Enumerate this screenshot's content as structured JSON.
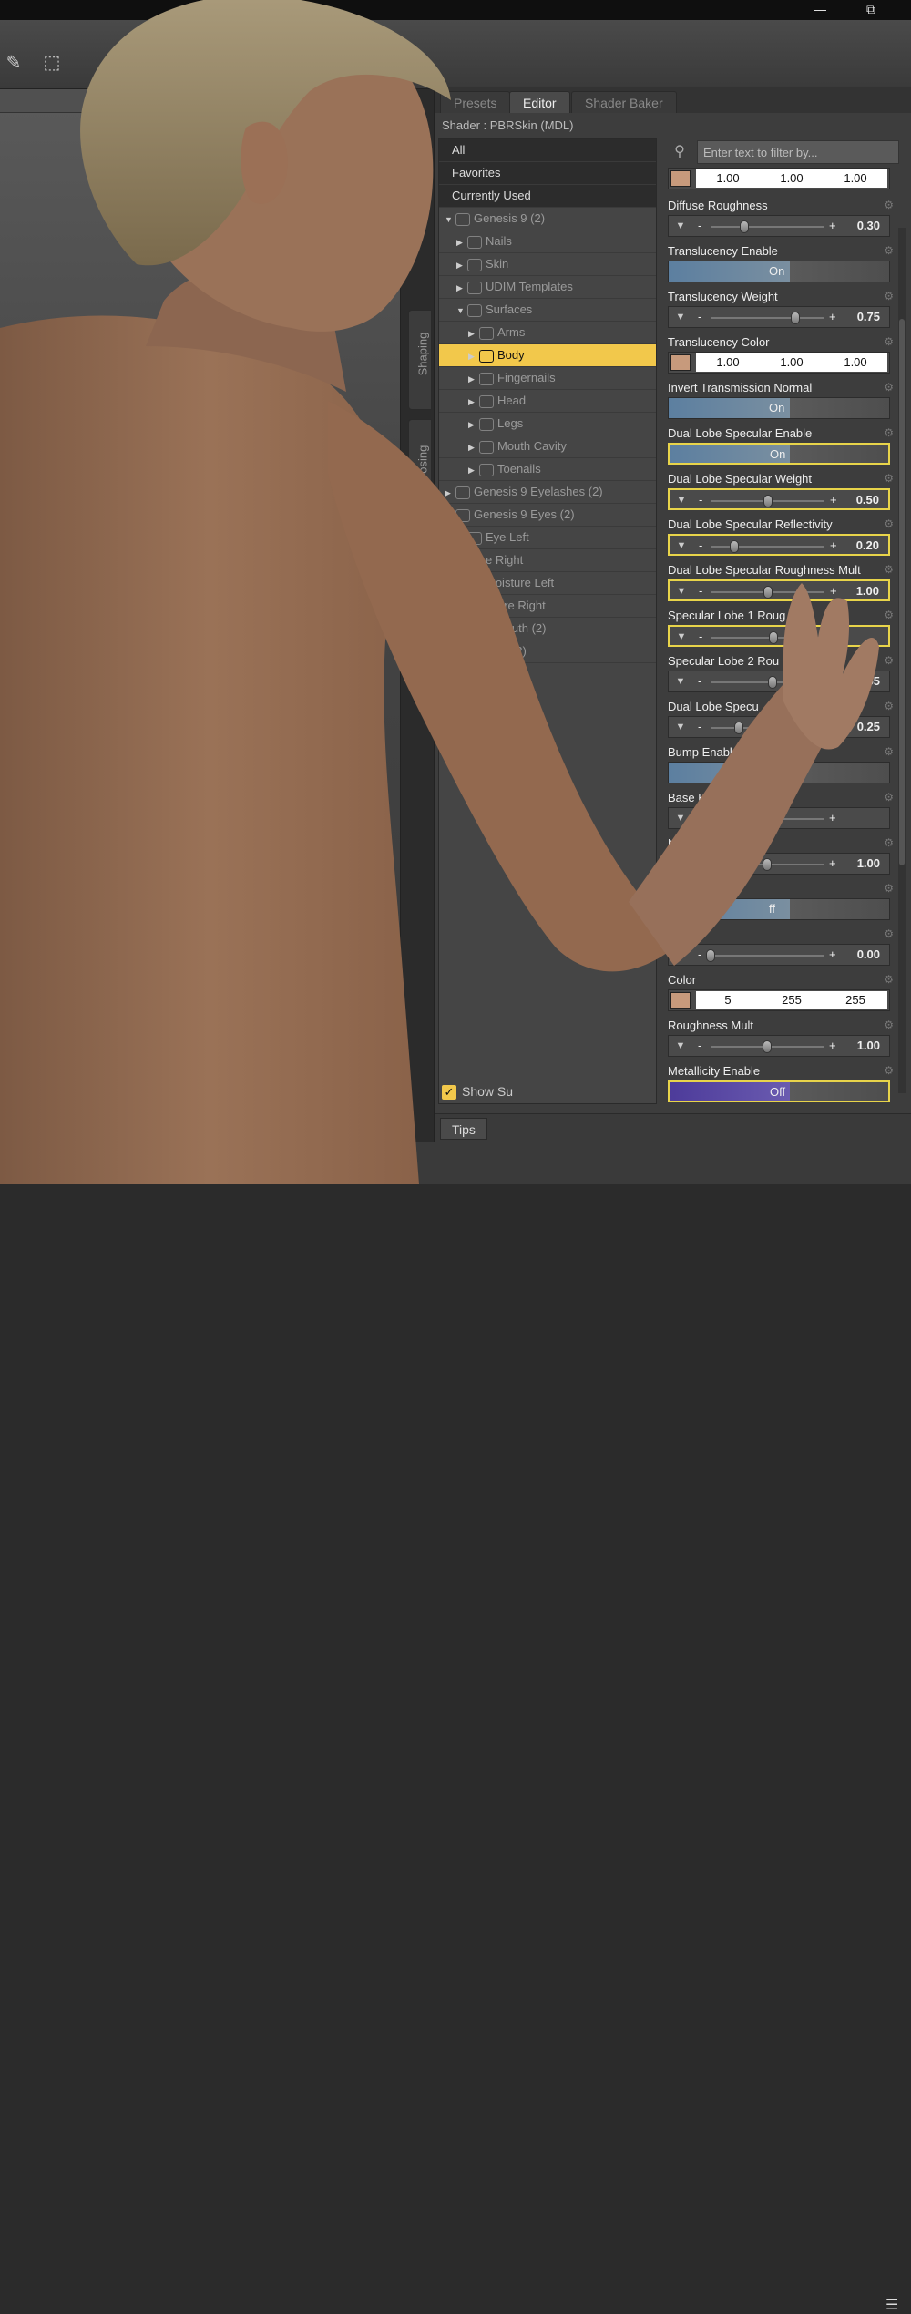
{
  "window": {
    "minimize": "—",
    "restore": "⧉"
  },
  "panel": {
    "tabs": [
      "Presets",
      "Editor",
      "Shader Baker"
    ],
    "shader_label": "Shader : PBRSkin (MDL)",
    "filter_placeholder": "Enter text to filter by...",
    "show_sub": "Show Su",
    "tips": "Tips"
  },
  "side_tabs": {
    "shaping": "Shaping",
    "posing": "Posing"
  },
  "tree": [
    {
      "label": "All",
      "type": "top"
    },
    {
      "label": "Favorites",
      "type": "top"
    },
    {
      "label": "Currently Used",
      "type": "top"
    },
    {
      "label": "Genesis 9 (2)",
      "indent": 0,
      "arrow": "▼"
    },
    {
      "label": "Nails",
      "indent": 1,
      "arrow": "▶"
    },
    {
      "label": "Skin",
      "indent": 1,
      "arrow": "▶"
    },
    {
      "label": "UDIM Templates",
      "indent": 1,
      "arrow": "▶"
    },
    {
      "label": "Surfaces",
      "indent": 1,
      "arrow": "▼"
    },
    {
      "label": "Arms",
      "indent": 2,
      "arrow": "▶"
    },
    {
      "label": "Body",
      "indent": 2,
      "arrow": "▶",
      "selected": true
    },
    {
      "label": "Fingernails",
      "indent": 2,
      "arrow": "▶"
    },
    {
      "label": "Head",
      "indent": 2,
      "arrow": "▶"
    },
    {
      "label": "Legs",
      "indent": 2,
      "arrow": "▶"
    },
    {
      "label": "Mouth Cavity",
      "indent": 2,
      "arrow": "▶"
    },
    {
      "label": "Toenails",
      "indent": 2,
      "arrow": "▶"
    },
    {
      "label": "Genesis 9 Eyelashes (2)",
      "indent": 0,
      "arrow": "▶"
    },
    {
      "label": "Genesis 9 Eyes (2)",
      "indent": 0,
      "arrow": "▶"
    },
    {
      "label": "Eye Left",
      "indent": 1,
      "arrow": ""
    },
    {
      "label": "e Right",
      "indent": 1,
      "arrow": ""
    },
    {
      "label": "Moisture Left",
      "indent": 1,
      "arrow": ""
    },
    {
      "label": "isture Right",
      "indent": 1,
      "arrow": ""
    },
    {
      "label": "9 Mouth (2)",
      "indent": 1,
      "arrow": ""
    },
    {
      "label": "Tear (2)",
      "indent": 1,
      "arrow": ""
    }
  ],
  "properties": [
    {
      "label": "",
      "type": "color",
      "values": [
        "1.00",
        "1.00",
        "1.00"
      ]
    },
    {
      "label": "Diffuse Roughness",
      "type": "slider",
      "value": "0.30",
      "pos": 0.3
    },
    {
      "label": "Translucency Enable",
      "type": "toggle",
      "value": "On"
    },
    {
      "label": "Translucency Weight",
      "type": "slider",
      "value": "0.75",
      "pos": 0.75
    },
    {
      "label": "Translucency Color",
      "type": "color",
      "values": [
        "1.00",
        "1.00",
        "1.00"
      ]
    },
    {
      "label": "Invert Transmission Normal",
      "type": "toggle",
      "value": "On"
    },
    {
      "label": "Dual Lobe Specular Enable",
      "type": "toggle",
      "value": "On",
      "hl": true
    },
    {
      "label": "Dual Lobe Specular Weight",
      "type": "slider",
      "value": "0.50",
      "pos": 0.5,
      "hl": true
    },
    {
      "label": "Dual Lobe Specular Reflectivity",
      "type": "slider",
      "value": "0.20",
      "pos": 0.2,
      "hl": true
    },
    {
      "label": "Dual Lobe Specular Roughness Mult",
      "type": "slider",
      "value": "1.00",
      "pos": 0.5,
      "hl": true
    },
    {
      "label": "Specular Lobe 1 Roug",
      "type": "slider",
      "value": "",
      "pos": 0.55,
      "hl": true
    },
    {
      "label": "Specular Lobe 2 Rou",
      "type": "slider",
      "value": "55",
      "pos": 0.55
    },
    {
      "label": "Dual Lobe Specu",
      "type": "slider",
      "value": "0.25",
      "pos": 0.25
    },
    {
      "label": "Bump Enable",
      "type": "toggle",
      "value": ""
    },
    {
      "label": "Base Bum",
      "type": "slider",
      "value": "",
      "pos": 0.0
    },
    {
      "label": "Normal",
      "type": "slider",
      "value": "1.00",
      "pos": 0.5
    },
    {
      "label": "",
      "type": "toggle",
      "value": "ff"
    },
    {
      "label": "",
      "type": "slider",
      "value": "0.00",
      "pos": 0.0
    },
    {
      "label": "Color",
      "type": "color",
      "values": [
        "5",
        "255",
        "255"
      ]
    },
    {
      "label": "Roughness Mult",
      "type": "slider",
      "value": "1.00",
      "pos": 0.5
    },
    {
      "label": "Metallicity Enable",
      "type": "toggle_purple",
      "value": "Off",
      "hl": true
    }
  ]
}
